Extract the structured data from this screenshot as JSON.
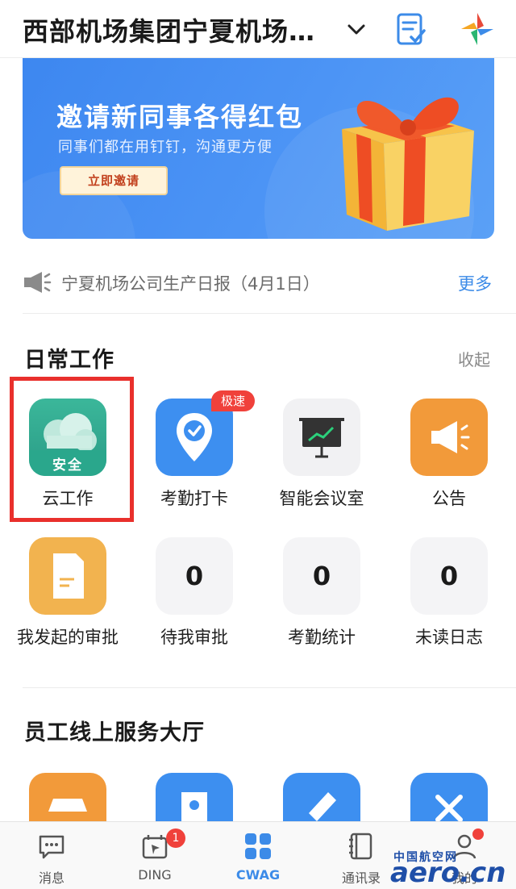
{
  "header": {
    "title": "西部机场集团宁夏机场…"
  },
  "banner": {
    "headline": "邀请新同事各得红包",
    "subtitle": "同事们都在用钉钉，沟通更方便",
    "invite_label": "立即邀请"
  },
  "notice": {
    "text": "宁夏机场公司生产日报（4月1日）",
    "more_label": "更多"
  },
  "daily_work": {
    "title": "日常工作",
    "collapse_label": "收起",
    "apps": [
      {
        "label": "云工作",
        "icon": "cloud-security-icon",
        "icon_text": "安全"
      },
      {
        "label": "考勤打卡",
        "icon": "location-check-icon",
        "badge": "极速"
      },
      {
        "label": "智能会议室",
        "icon": "presentation-board-icon"
      },
      {
        "label": "公告",
        "icon": "megaphone-icon"
      },
      {
        "label": "我发起的审批",
        "icon": "document-icon"
      },
      {
        "label": "待我审批",
        "count": "0"
      },
      {
        "label": "考勤统计",
        "count": "0"
      },
      {
        "label": "未读日志",
        "count": "0"
      }
    ]
  },
  "services": {
    "title": "员工线上服务大厅"
  },
  "tabbar": {
    "items": [
      {
        "label": "消息",
        "icon": "chat-bubble-icon"
      },
      {
        "label": "DING",
        "icon": "ding-icon",
        "badge": "1"
      },
      {
        "label": "CWAG",
        "icon": "grid-apps-icon"
      },
      {
        "label": "通讯录",
        "icon": "contacts-book-icon"
      },
      {
        "label": "我的",
        "icon": "profile-icon"
      }
    ]
  },
  "watermark": {
    "cn": "中国航空网",
    "en": "aero.cn"
  },
  "colors": {
    "accent": "#3c8be8",
    "highlight": "#e9302c",
    "badge": "#f0413b"
  }
}
